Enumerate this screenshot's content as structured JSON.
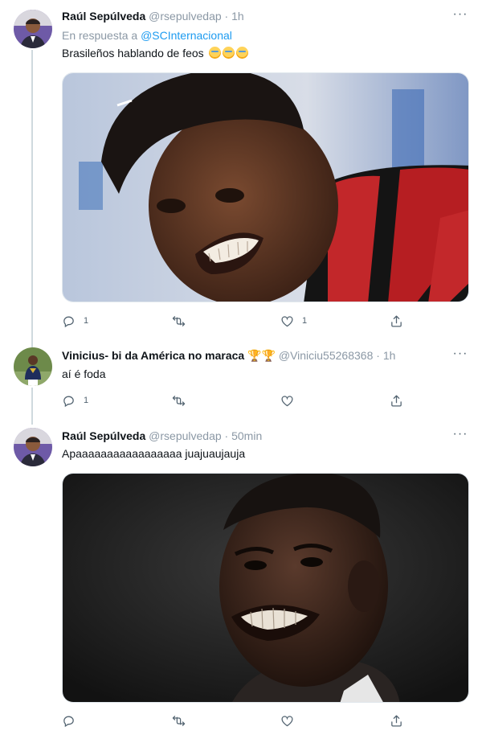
{
  "tweets": [
    {
      "name": "Raúl Sepúlveda",
      "handle": "@rsepulvedap",
      "separator": "·",
      "time": "1h",
      "reply_prefix": "En respuesta a",
      "reply_mention": "@SCInternacional",
      "text": "Brasileños hablando de feos",
      "emoji": [
        "face-with-tears-of-joy",
        "face-with-tears-of-joy",
        "face-with-tears-of-joy"
      ],
      "media": "photo-smiling-footballer",
      "replies": "1",
      "retweets": "",
      "likes": "1"
    },
    {
      "name": "Vinicius- bi da América no maraca",
      "name_emoji": [
        "trophy",
        "trophy"
      ],
      "handle": "@Viniciu55268368",
      "separator": "·",
      "time": "1h",
      "text": "aí é foda",
      "replies": "1",
      "retweets": "",
      "likes": ""
    },
    {
      "name": "Raúl Sepúlveda",
      "handle": "@rsepulvedap",
      "separator": "·",
      "time": "50min",
      "text": "Apaaaaaaaaaaaaaaaaa juajuaujauja",
      "media": "photo-grimacing-footballer",
      "replies": "",
      "retweets": "",
      "likes": ""
    }
  ],
  "more_label": "···",
  "colors": {
    "link": "#1d9bf0",
    "muted": "#8b98a5",
    "text": "#0f1419",
    "line": "#cfd9de"
  }
}
